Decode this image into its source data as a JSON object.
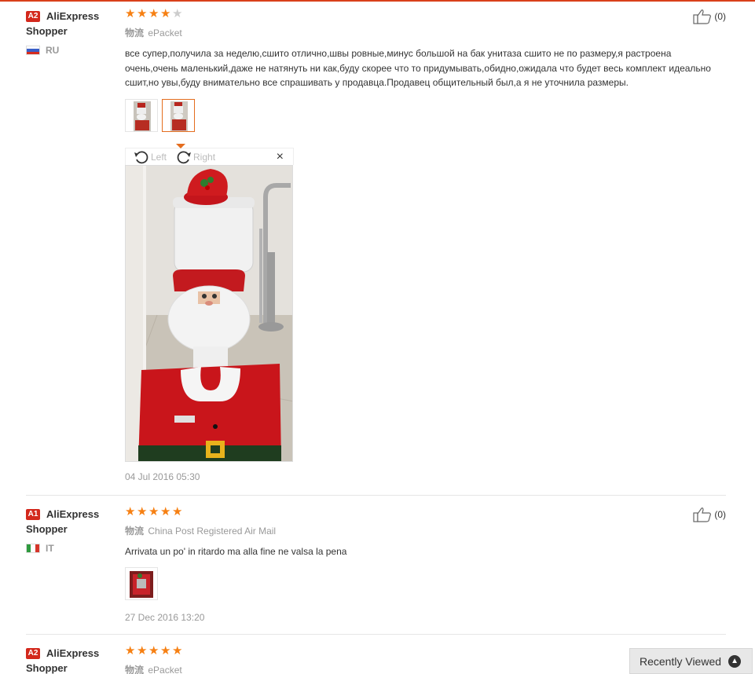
{
  "reviews": [
    {
      "badge": "A2",
      "user_line1": "AliExpress",
      "user_line2": "Shopper",
      "country": "RU",
      "rating": 4,
      "shipping_label": "物流",
      "shipping_method": "ePacket",
      "text": "все супер,получила за неделю,сшито отлично,швы ровные,минус большой на бак унитаза сшито не по размеру,я растроена очень,очень маленький,даже не натянуть ни как,буду скорее что то придумывать,обидно,ожидала что будет весь комплект идеально сшит,но увы,буду внимательно все спрашивать у продавца.Продавец общительный был,а я не уточнила размеры.",
      "date": "04 Jul 2016 05:30",
      "helpful": "(0)"
    },
    {
      "badge": "A1",
      "user_line1": "AliExpress",
      "user_line2": "Shopper",
      "country": "IT",
      "rating": 5,
      "shipping_label": "物流",
      "shipping_method": "China Post Registered Air Mail",
      "text": "Arrivata un po' in ritardo ma alla fine ne valsa la pena",
      "date": "27 Dec 2016 13:20",
      "helpful": "(0)"
    },
    {
      "badge": "A2",
      "user_line1": "AliExpress",
      "user_line2": "Shopper",
      "rating": 5,
      "shipping_label": "物流",
      "shipping_method": "ePacket"
    }
  ],
  "viewer": {
    "left_label": "Left",
    "right_label": "Right",
    "close_glyph": "×"
  },
  "recently_viewed": "Recently Viewed",
  "colors": {
    "accent": "#d9401a",
    "star": "#f68013",
    "badge": "#d3281c"
  }
}
